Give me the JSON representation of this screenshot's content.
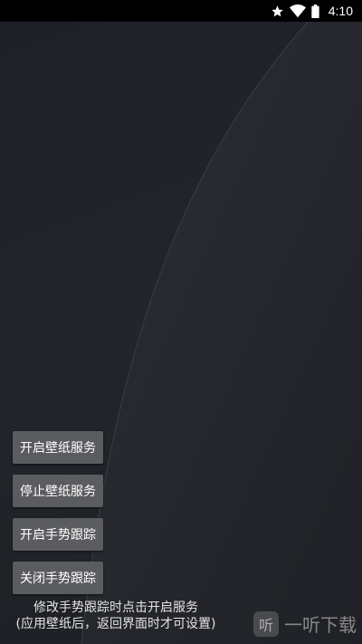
{
  "status_bar": {
    "time": "4:10",
    "icons": [
      "star-icon",
      "wifi-icon",
      "battery-icon"
    ]
  },
  "buttons": {
    "start_wallpaper": "开启壁纸服务",
    "stop_wallpaper": "停止壁纸服务",
    "start_gesture": "开启手势跟踪",
    "stop_gesture": "关闭手势跟踪"
  },
  "hint": {
    "line1": "修改手势跟踪时点击开启服务",
    "line2": "(应用壁纸后，返回界面时才可设置)"
  },
  "watermark": {
    "logo_char": "听",
    "text": "一听下载"
  },
  "colors": {
    "button_bg": "#5b5c5f",
    "background": "#1e2127",
    "status_bar": "#000000"
  }
}
